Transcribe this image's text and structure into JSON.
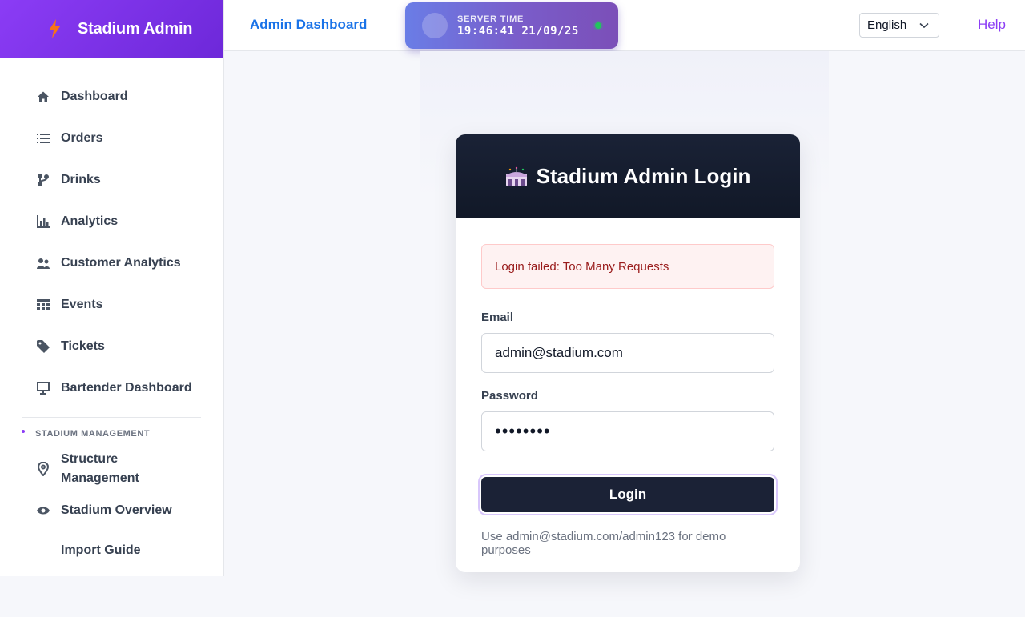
{
  "app": {
    "name": "Stadium Admin",
    "brand_color": "#8b3cf5"
  },
  "sidebar": {
    "items": [
      {
        "label": "Dashboard",
        "icon": "home-icon"
      },
      {
        "label": "Orders",
        "icon": "list-icon"
      },
      {
        "label": "Drinks",
        "icon": "branch-icon"
      },
      {
        "label": "Analytics",
        "icon": "bar-chart-icon"
      },
      {
        "label": "Customer Analytics",
        "icon": "users-icon"
      },
      {
        "label": "Events",
        "icon": "calendar-icon"
      },
      {
        "label": "Tickets",
        "icon": "tag-icon"
      },
      {
        "label": "Bartender Dashboard",
        "icon": "monitor-icon"
      }
    ],
    "section": {
      "title": "STADIUM MANAGEMENT",
      "items": [
        {
          "label": "Structure Management",
          "icon": "map-pin-icon"
        },
        {
          "label": "Stadium Overview",
          "icon": "eye-icon"
        },
        {
          "label": "Import Guide",
          "icon": ""
        }
      ]
    }
  },
  "header": {
    "title": "Admin Dashboard",
    "server_time": {
      "label": "SERVER TIME",
      "value": "19:46:41 21/09/25",
      "status_color": "#22c55e"
    },
    "language": "English",
    "help": "Help"
  },
  "login": {
    "title": "Stadium Admin Login",
    "icon": "stadium-icon",
    "error": "Login failed: Too Many Requests",
    "email_label": "Email",
    "email_value": "admin@stadium.com",
    "password_label": "Password",
    "password_value": "••••••••",
    "button": "Login",
    "hint": "Use admin@stadium.com/admin123 for demo purposes"
  }
}
